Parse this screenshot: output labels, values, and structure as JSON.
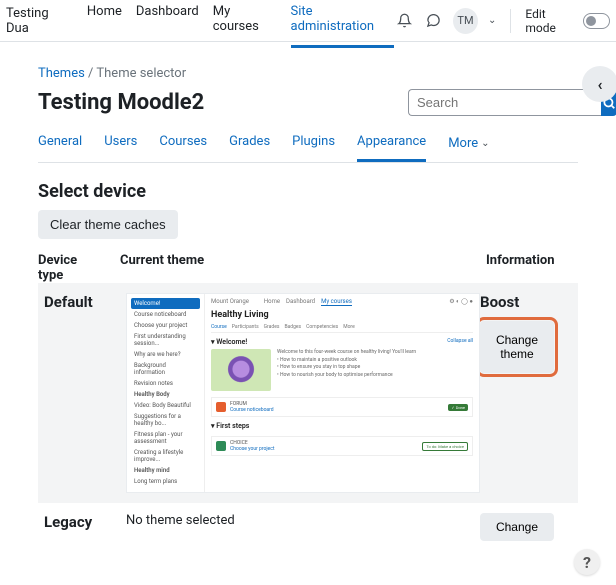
{
  "topbar": {
    "brand": "Testing Dua",
    "nav": [
      "Home",
      "Dashboard",
      "My courses",
      "Site administration"
    ],
    "nav_active": 3,
    "user_initials": "TM",
    "edit_mode_label": "Edit mode"
  },
  "breadcrumb": {
    "link": "Themes",
    "sep": " / ",
    "current": "Theme selector"
  },
  "page_title": "Testing Moodle2",
  "search": {
    "placeholder": "Search"
  },
  "tabs": {
    "items": [
      "General",
      "Users",
      "Courses",
      "Grades",
      "Plugins",
      "Appearance"
    ],
    "more": "More",
    "active": 5
  },
  "section_title": "Select device",
  "clear_caches": "Clear theme caches",
  "columns": {
    "c1a": "Device",
    "c1b": "type",
    "c2": "Current theme",
    "c3": "Information"
  },
  "rows": {
    "default": {
      "device": "Default",
      "info_title": "Boost",
      "change": "Change theme",
      "preview": {
        "site": "Mount Orange",
        "nav": [
          "Home",
          "Dashboard",
          "My courses"
        ],
        "side": [
          "Welcome!",
          "Course noticeboard",
          "Choose your project",
          "First understanding session...",
          "Why are we here?",
          "Background information",
          "Revision notes",
          "Healthy Body",
          "Video: Body Beautiful",
          "Suggestions for a healthy bo...",
          "Fitness plan - your assessment",
          "Creating a lifestyle improve...",
          "Healthy mind",
          "Long term plans"
        ],
        "course_title": "Healthy Living",
        "tabs": [
          "Course",
          "Participants",
          "Grades",
          "Badges",
          "Competencies",
          "More"
        ],
        "sec1": "Welcome!",
        "collapse": "Collapse all",
        "intro": "Welcome to this four-week course on healthy living! You'll learn",
        "bullets": [
          "How to maintain a positive outlook",
          "How to ensure you stay in top shape",
          "How to nourish your body to optimise performance"
        ],
        "card1": {
          "title": "FORUM",
          "sub": "Course noticeboard",
          "badge": "✓ Done"
        },
        "sec2": "First steps",
        "card2": {
          "title": "CHOICE",
          "sub": "Choose your project",
          "badge": "To do: Make a choice"
        }
      }
    },
    "legacy": {
      "device": "Legacy",
      "no_theme": "No theme selected",
      "change": "Change"
    }
  },
  "help": "?"
}
